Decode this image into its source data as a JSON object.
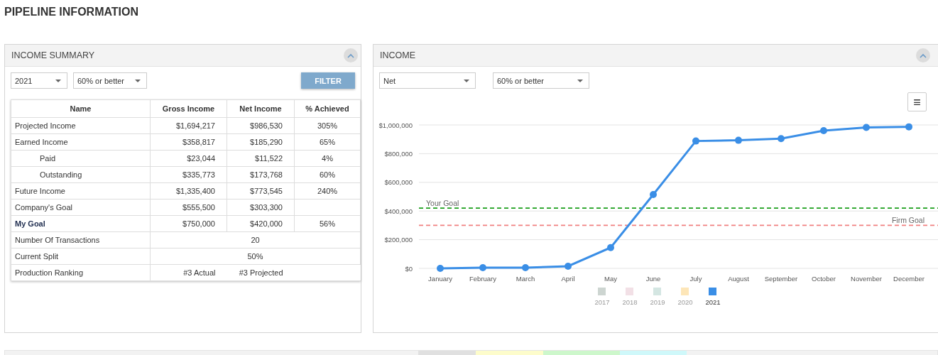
{
  "page_title": "PIPELINE INFORMATION",
  "summary": {
    "title": "INCOME SUMMARY",
    "filters": [
      {
        "value": "2021"
      },
      {
        "value": "60% or better"
      }
    ],
    "filter_button": "FILTER",
    "table": {
      "columns": [
        "Name",
        "Gross Income",
        "Net Income",
        "% Achieved"
      ],
      "rows": [
        {
          "kind": "values",
          "bold": false,
          "cells": [
            "Projected Income",
            "$1,694,217",
            "$986,530",
            "305%"
          ]
        },
        {
          "kind": "values",
          "bold": false,
          "cells": [
            "Earned Income",
            "$358,817",
            "$185,290",
            "65%"
          ],
          "children": [
            {
              "kind": "values",
              "bold": false,
              "cells": [
                "Paid",
                "$23,044",
                "$11,522",
                "4%"
              ]
            },
            {
              "kind": "values",
              "bold": false,
              "cells": [
                "Outstanding",
                "$335,773",
                "$173,768",
                "60%"
              ]
            }
          ]
        },
        {
          "kind": "values",
          "bold": false,
          "cells": [
            "Future Income",
            "$1,335,400",
            "$773,545",
            "240%"
          ]
        },
        {
          "kind": "values",
          "bold": false,
          "cells": [
            "Company's Goal",
            "$555,500",
            "$303,300"
          ]
        },
        {
          "kind": "values",
          "bold": true,
          "cells": [
            "My Goal",
            "$750,000",
            "$420,000",
            "56%"
          ]
        },
        {
          "kind": "span",
          "bold": false,
          "cells": [
            "Number Of Transactions",
            {
              "text": "20",
              "colspan": 3
            }
          ]
        },
        {
          "kind": "span",
          "bold": false,
          "cells": [
            "Current Split",
            {
              "text": "50%",
              "colspan": 3
            }
          ]
        },
        {
          "kind": "pair",
          "bold": false,
          "cells": [
            "Production Ranking",
            "#3 Actual",
            "#3 Projected"
          ]
        }
      ]
    }
  },
  "income": {
    "title": "INCOME",
    "filters": [
      {
        "value": "Net"
      },
      {
        "value": "60% or better"
      }
    ],
    "menu_icon": "≡",
    "legend": [
      {
        "label": "2017",
        "color": "#c8d0cc",
        "visible": false
      },
      {
        "label": "2018",
        "color": "#f1dde3",
        "visible": false
      },
      {
        "label": "2019",
        "color": "#cfe3df",
        "visible": false
      },
      {
        "label": "2020",
        "color": "#fde3b0",
        "visible": false
      }
    ],
    "chart_data": {
      "type": "line",
      "categories": [
        "January",
        "February",
        "March",
        "April",
        "May",
        "June",
        "July",
        "August",
        "September",
        "October",
        "November",
        "December"
      ],
      "ylim": [
        0,
        1000000
      ],
      "grid": true,
      "yticks": [
        {
          "value": 0,
          "label": "$0"
        },
        {
          "value": 200000,
          "label": "$200,000"
        },
        {
          "value": 400000,
          "label": "$400,000"
        },
        {
          "value": 600000,
          "label": "$600,000"
        },
        {
          "value": 800000,
          "label": "$800,000"
        },
        {
          "value": 1000000,
          "label": "$1,000,000"
        }
      ],
      "series": [
        {
          "name": "2021",
          "color": "#3a8ee6",
          "marker": "circle",
          "values": [
            0,
            5000,
            5000,
            15000,
            145000,
            515000,
            888000,
            893000,
            905000,
            960000,
            983000,
            987000
          ]
        }
      ],
      "ref_lines": [
        {
          "axis": "y",
          "value": 420000,
          "label": "Your Goal",
          "color": "#1a9e1a"
        },
        {
          "axis": "y",
          "value": 300000,
          "label": "Firm Goal",
          "color": "#f08080"
        }
      ]
    }
  }
}
